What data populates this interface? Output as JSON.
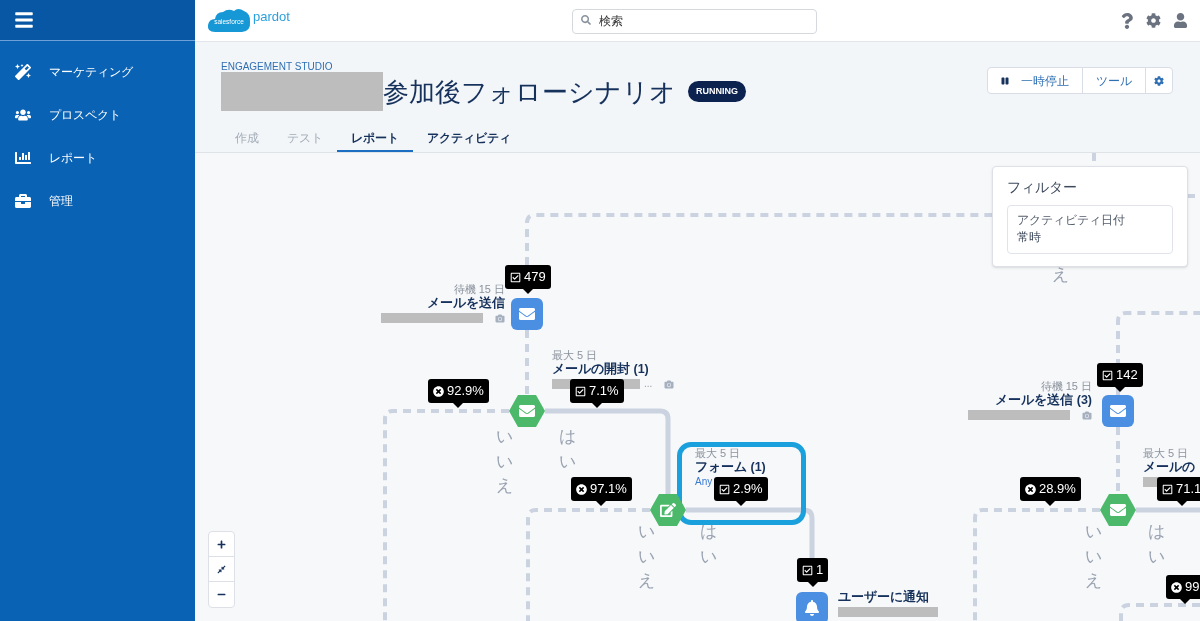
{
  "topbar": {
    "logo_cloud": "salesforce",
    "logo_text": "pardot",
    "search": {
      "placeholder": "検索"
    }
  },
  "sidebar": {
    "items": [
      {
        "label": "マーケティング"
      },
      {
        "label": "プロスペクト"
      },
      {
        "label": "レポート"
      },
      {
        "label": "管理"
      }
    ]
  },
  "header": {
    "eyebrow": "ENGAGEMENT STUDIO",
    "title": "参加後フォローシナリオ",
    "status": "RUNNING",
    "buttons": [
      "一時停止",
      "ツール"
    ]
  },
  "tabs": [
    {
      "label": "作成",
      "selected": false,
      "disabled": true
    },
    {
      "label": "テスト",
      "selected": false,
      "disabled": true
    },
    {
      "label": "レポート",
      "selected": true,
      "disabled": false
    },
    {
      "label": "アクティビティ",
      "selected": false,
      "disabled": false
    }
  ],
  "filter": {
    "title": "フィルター",
    "field_label": "アクティビティ日付",
    "field_value": "常時"
  },
  "flow": {
    "nodes": [
      {
        "kind": "send",
        "meta": "待機 15 日",
        "name": "メールを送信"
      },
      {
        "kind": "condition",
        "meta": "最大 5 日",
        "name": "メールの開封 (1)",
        "detail": "..."
      },
      {
        "kind": "form",
        "meta": "最大 5 日",
        "name": "フォーム (1)",
        "link": "Any"
      },
      {
        "kind": "notify",
        "name": "ユーザーに通知"
      },
      {
        "kind": "send",
        "meta": "待機 15 日",
        "name": "メールを送信 (3)"
      },
      {
        "kind": "condition",
        "meta": "最大 5 日",
        "name": "メールの"
      }
    ],
    "badges": [
      {
        "kind": "check",
        "text": "479"
      },
      {
        "kind": "cross",
        "text": "92.9%"
      },
      {
        "kind": "check",
        "text": "7.1%"
      },
      {
        "kind": "cross",
        "text": "97.1%"
      },
      {
        "kind": "check",
        "text": "2.9%"
      },
      {
        "kind": "check",
        "text": "1"
      },
      {
        "kind": "check",
        "text": "142"
      },
      {
        "kind": "cross",
        "text": "28.9%"
      },
      {
        "kind": "check",
        "text": "71.1"
      },
      {
        "kind": "cross",
        "text": "99"
      }
    ],
    "branch_labels": [
      "いいえ",
      "はい",
      "いいえ",
      "はい",
      "いいえ",
      "はい",
      "え"
    ]
  }
}
